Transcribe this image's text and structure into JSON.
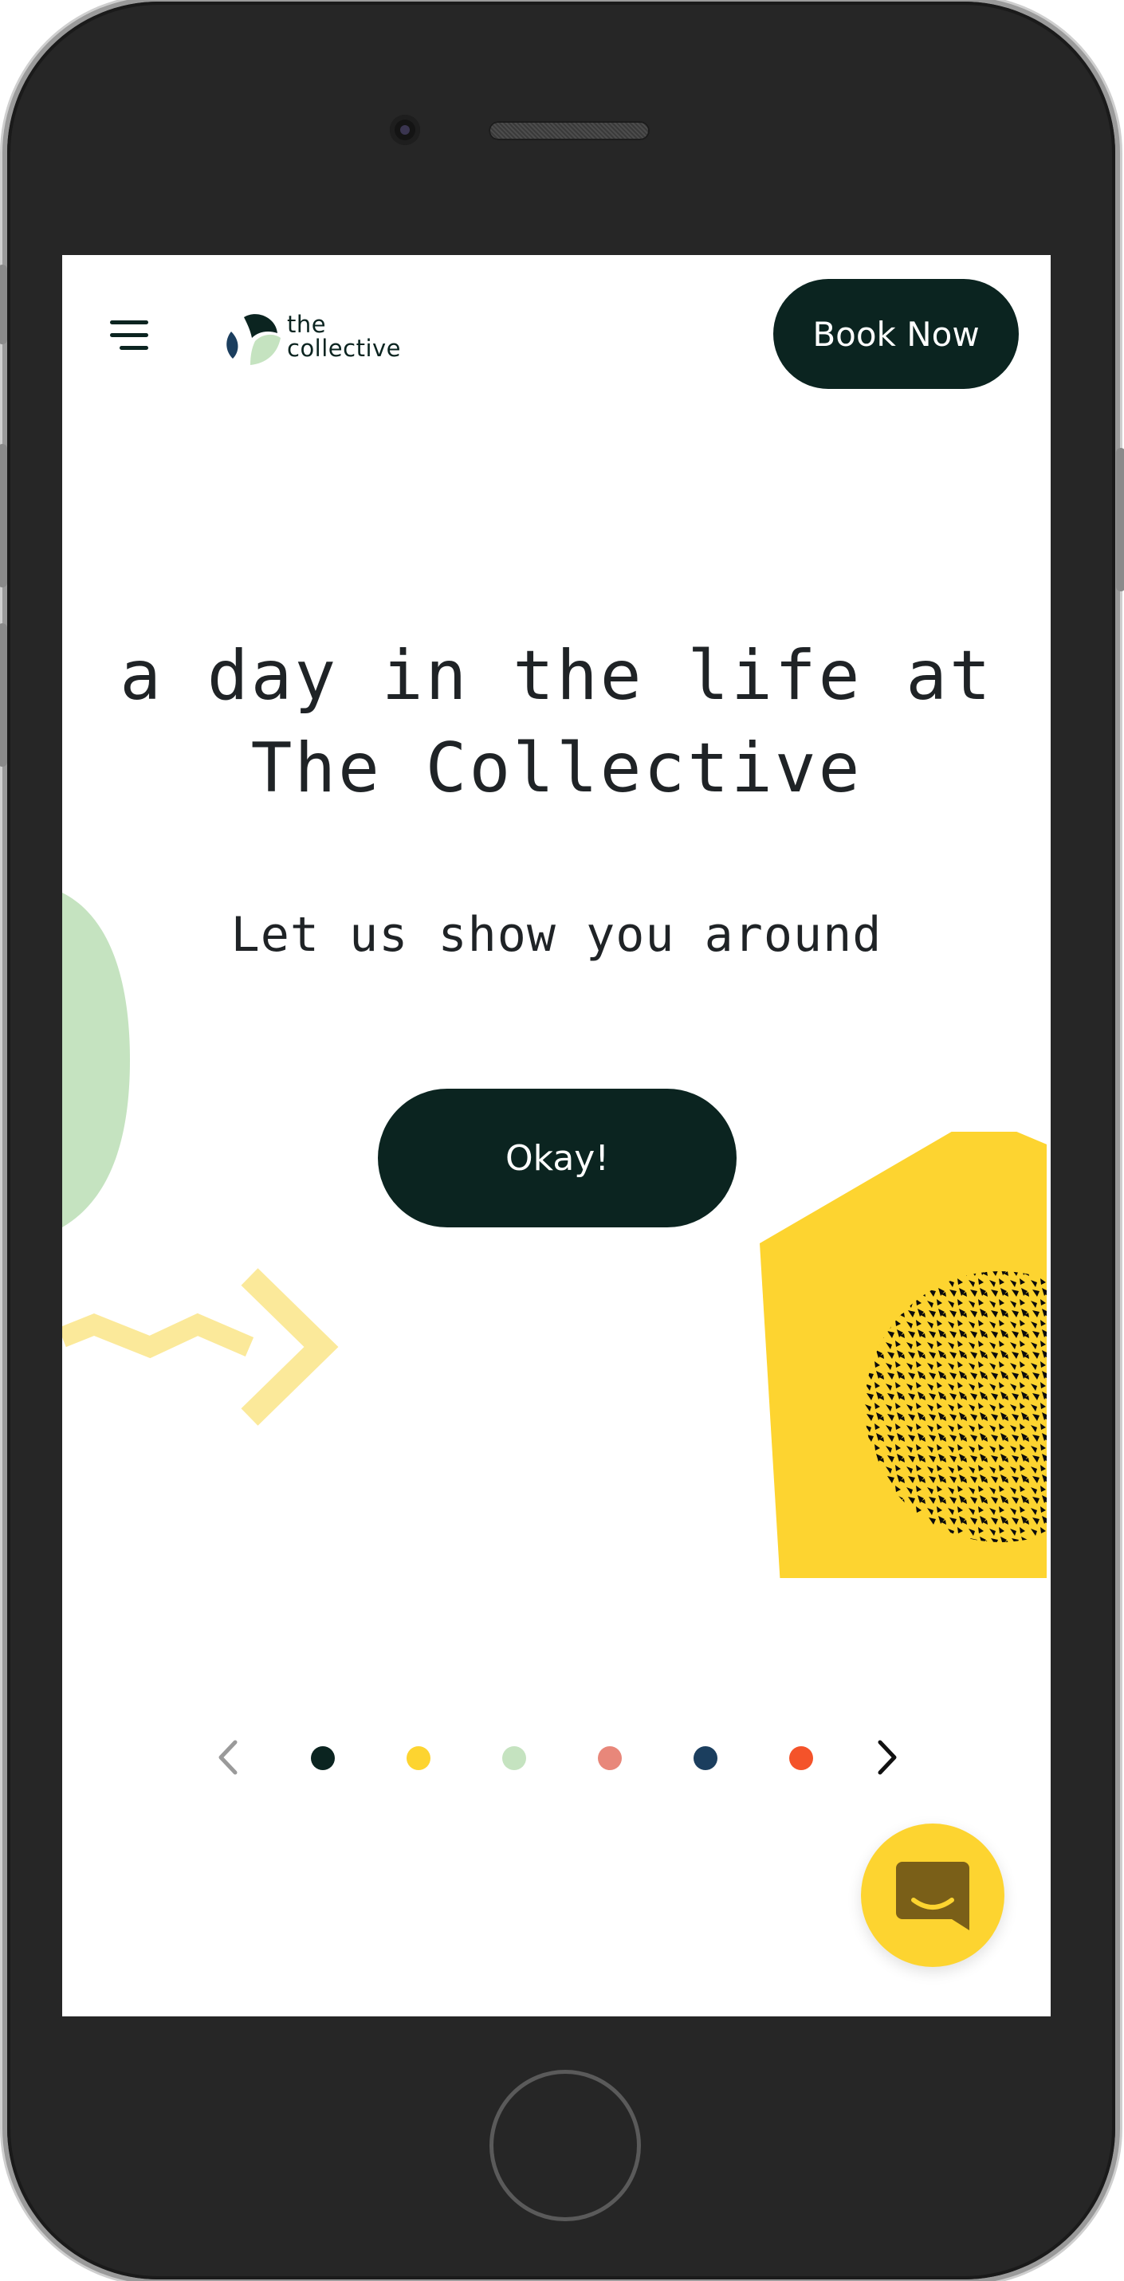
{
  "header": {
    "menu_icon": "hamburger-icon",
    "logo": {
      "line1": "the",
      "line2": "collective",
      "icon": "leaf-logo-icon"
    },
    "book_button_label": "Book Now"
  },
  "hero": {
    "title_line1": "a day in the life at",
    "title_line2": "The Collective",
    "subtitle": "Let us show you around",
    "cta_label": "Okay!"
  },
  "pager": {
    "prev_icon": "chevron-left-icon",
    "next_icon": "chevron-right-icon",
    "dots": [
      {
        "color": "#0b2420"
      },
      {
        "color": "#fdd430"
      },
      {
        "color": "#c5e3c0"
      },
      {
        "color": "#e8877a"
      },
      {
        "color": "#1b3e5e"
      },
      {
        "color": "#f4532a"
      }
    ]
  },
  "chat_widget": {
    "icon": "chat-smile-icon"
  },
  "colors": {
    "dark": "#0b2420",
    "yellow": "#fdd430",
    "light_green": "#c5e3c0",
    "pale_yellow": "#fbe99a",
    "text": "#1f2326"
  }
}
